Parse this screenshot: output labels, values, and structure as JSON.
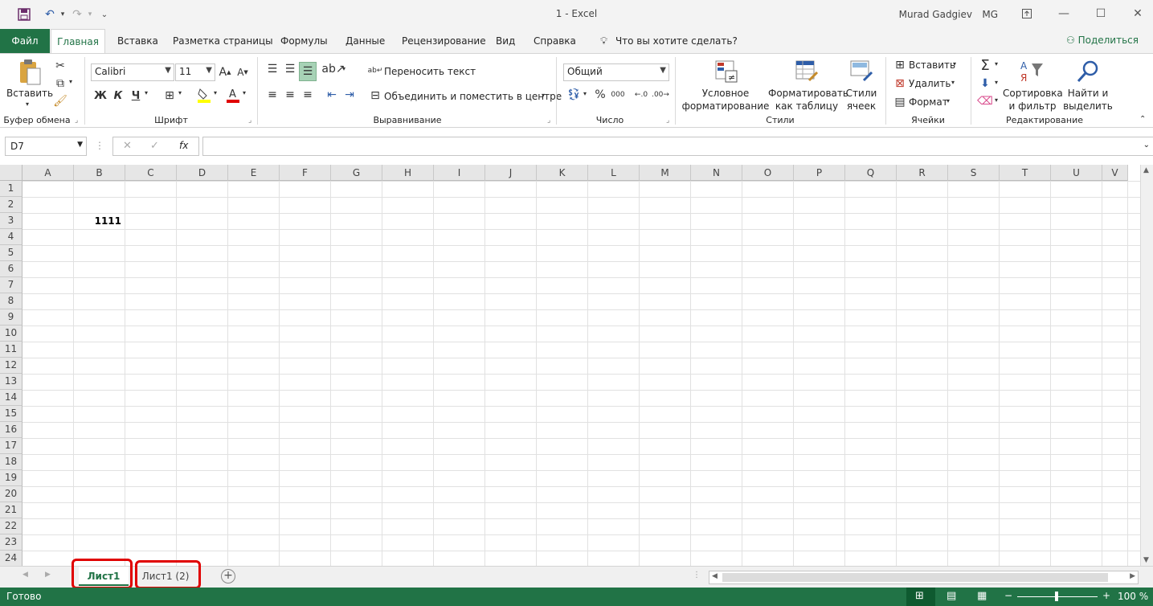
{
  "titlebar": {
    "title": "1  -  Excel",
    "user_name": "Murad Gadgiev",
    "user_initials": "MG"
  },
  "ribbon_tabs": [
    "Файл",
    "Главная",
    "Вставка",
    "Разметка страницы",
    "Формулы",
    "Данные",
    "Рецензирование",
    "Вид",
    "Справка"
  ],
  "tell_me": "Что вы хотите сделать?",
  "share_label": "Поделиться",
  "ribbon": {
    "clipboard": {
      "paste": "Вставить",
      "label": "Буфер обмена"
    },
    "font": {
      "name": "Calibri",
      "size": "11",
      "bold": "Ж",
      "italic": "К",
      "underline": "Ч",
      "label": "Шрифт"
    },
    "alignment": {
      "wrap": "Переносить текст",
      "merge": "Объединить и поместить в центре",
      "label": "Выравнивание"
    },
    "number": {
      "format": "Общий",
      "percent": "%",
      "thousands": "000",
      "label": "Число"
    },
    "styles": {
      "conditional_1": "Условное",
      "conditional_2": "форматирование",
      "table_1": "Форматировать",
      "table_2": "как таблицу",
      "cell_1": "Стили",
      "cell_2": "ячеек",
      "label": "Стили"
    },
    "cells": {
      "insert": "Вставить",
      "delete": "Удалить",
      "format": "Формат",
      "label": "Ячейки"
    },
    "editing": {
      "sort_1": "Сортировка",
      "sort_2": "и фильтр",
      "find_1": "Найти и",
      "find_2": "выделить",
      "label": "Редактирование"
    }
  },
  "formula_bar": {
    "name_box": "D7",
    "fx": "fx",
    "value": ""
  },
  "columns": [
    "A",
    "B",
    "C",
    "D",
    "E",
    "F",
    "G",
    "H",
    "I",
    "J",
    "K",
    "L",
    "M",
    "N",
    "O",
    "P",
    "Q",
    "R",
    "S",
    "T",
    "U",
    "V"
  ],
  "rows": [
    "1",
    "2",
    "3",
    "4",
    "5",
    "6",
    "7",
    "8",
    "9",
    "10",
    "11",
    "12",
    "13",
    "14",
    "15",
    "16",
    "17",
    "18",
    "19",
    "20",
    "21",
    "22",
    "23",
    "24"
  ],
  "cells": {
    "B3": "1111"
  },
  "sheets": [
    {
      "name": "Лист1",
      "active": true
    },
    {
      "name": "Лист1 (2)",
      "active": false
    }
  ],
  "status": {
    "ready": "Готово",
    "zoom": "100 %"
  },
  "colors": {
    "accent": "#217346",
    "highlight": "#e00000"
  }
}
